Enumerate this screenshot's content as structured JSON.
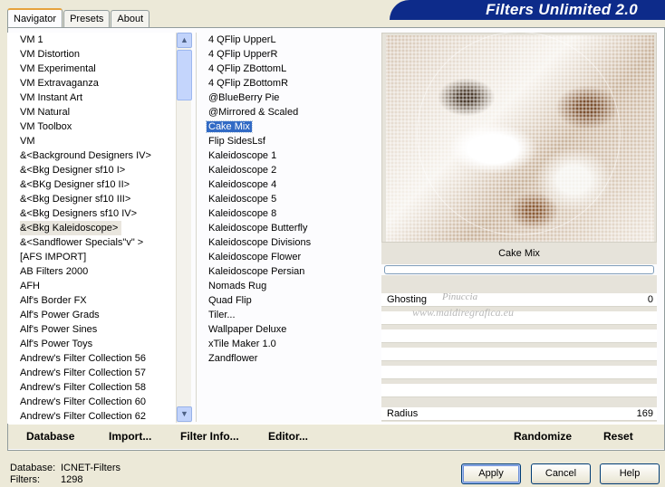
{
  "app": {
    "banner_title": "Filters Unlimited 2.0"
  },
  "tabs": [
    {
      "label": "Navigator",
      "active": true
    },
    {
      "label": "Presets",
      "active": false
    },
    {
      "label": "About",
      "active": false
    }
  ],
  "categories": [
    "VM 1",
    "VM Distortion",
    "VM Experimental",
    "VM Extravaganza",
    "VM Instant Art",
    "VM Natural",
    "VM Toolbox",
    "VM",
    "&<Background Designers IV>",
    "&<Bkg Designer sf10 I>",
    "&<BKg Designer sf10 II>",
    "&<Bkg Designer sf10 III>",
    "&<Bkg Designers sf10 IV>",
    "&<Bkg Kaleidoscope>",
    "&<Sandflower Specials\"v\" >",
    "[AFS IMPORT]",
    "AB Filters 2000",
    "AFH",
    "Alf's Border FX",
    "Alf's Power Grads",
    "Alf's Power Sines",
    "Alf's Power Toys",
    "Andrew's Filter Collection 56",
    "Andrew's Filter Collection 57",
    "Andrew's Filter Collection 58",
    "Andrew's Filter Collection 60",
    "Andrew's Filter Collection 62"
  ],
  "selected_category": "&<Bkg Kaleidoscope>",
  "filters": [
    "4 QFlip UpperL",
    "4 QFlip UpperR",
    "4 QFlip ZBottomL",
    "4 QFlip ZBottomR",
    "@BlueBerry Pie",
    "@Mirrored & Scaled",
    "Cake Mix",
    "Flip SidesLsf",
    "Kaleidoscope 1",
    "Kaleidoscope 2",
    "Kaleidoscope 4",
    "Kaleidoscope 5",
    "Kaleidoscope 8",
    "Kaleidoscope Butterfly",
    "Kaleidoscope Divisions",
    "Kaleidoscope Flower",
    "Kaleidoscope Persian",
    "Nomads Rug",
    "Quad Flip",
    "Tiler...",
    "Wallpaper Deluxe",
    "xTile Maker 1.0",
    "Zandflower"
  ],
  "selected_filter": "Cake Mix",
  "preview": {
    "filter_name": "Cake Mix",
    "progress": 0
  },
  "params": [
    {
      "label": "Ghosting",
      "value": "0"
    },
    {
      "label": "Radius",
      "value": "169"
    }
  ],
  "watermark": {
    "line1": "Pinuccia",
    "line2": "www.maidiregrafica.eu"
  },
  "links": {
    "database": "Database",
    "import": "Import...",
    "filter_info": "Filter Info...",
    "editor": "Editor...",
    "randomize": "Randomize",
    "reset": "Reset"
  },
  "status": {
    "database_label": "Database:",
    "database_value": "ICNET-Filters",
    "filters_label": "Filters:",
    "filters_value": "1298"
  },
  "buttons": {
    "apply": "Apply",
    "cancel": "Cancel",
    "help": "Help"
  },
  "colors": {
    "banner": "#0d2b8a",
    "selection": "#316ac5",
    "tab_accent": "#e6a23c"
  }
}
